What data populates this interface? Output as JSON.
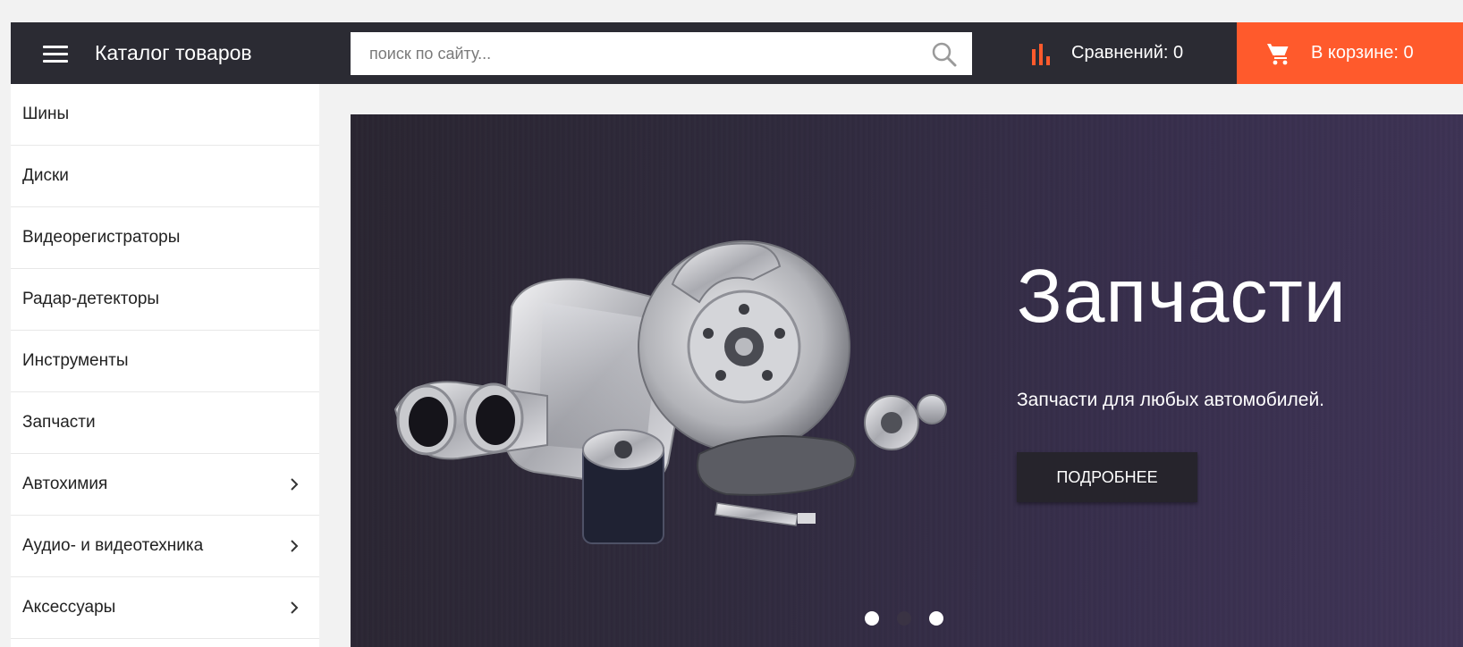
{
  "header": {
    "catalog_label": "Каталог товаров",
    "search_placeholder": "поиск по сайту...",
    "compare_label": "Сравнений: 0",
    "cart_label": "В корзине: 0"
  },
  "sidebar": {
    "items": [
      {
        "label": "Шины",
        "has_submenu": false
      },
      {
        "label": "Диски",
        "has_submenu": false
      },
      {
        "label": "Видеорегистраторы",
        "has_submenu": false
      },
      {
        "label": "Радар-детекторы",
        "has_submenu": false
      },
      {
        "label": "Инструменты",
        "has_submenu": false
      },
      {
        "label": "Запчасти",
        "has_submenu": false
      },
      {
        "label": "Автохимия",
        "has_submenu": true
      },
      {
        "label": "Аудио- и видеотехника",
        "has_submenu": true
      },
      {
        "label": "Аксессуары",
        "has_submenu": true
      }
    ]
  },
  "banner": {
    "title": "Запчасти",
    "subtitle": "Запчасти для любых автомобилей.",
    "button_label": "ПОДРОБНЕЕ",
    "active_slide": 1,
    "slide_count": 3
  },
  "colors": {
    "header_bg": "#2b2b33",
    "accent": "#ff5a2c",
    "banner_bg": "#322b42"
  },
  "icons": {
    "menu": "hamburger-icon",
    "search": "search-icon",
    "compare": "bar-chart-icon",
    "cart": "cart-icon",
    "submenu": "chevron-right-icon"
  }
}
